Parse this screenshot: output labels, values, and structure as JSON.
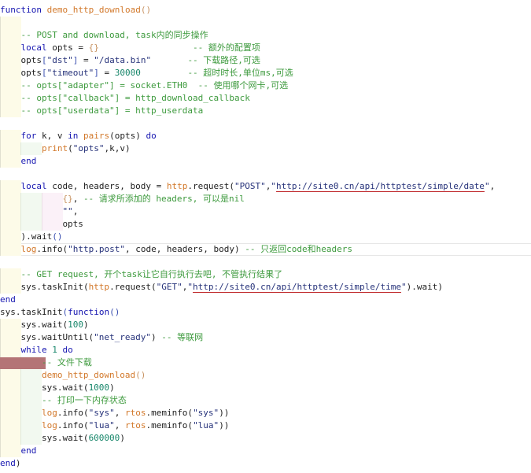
{
  "editor": {
    "language": "lua",
    "current_line": 20,
    "breakpoint_line": 29,
    "colors": {
      "keyword": "#1515b0",
      "function": "#d2782a",
      "comment": "#3d9a3d",
      "string": "#26327a",
      "number": "#17866a",
      "breakpoint": "#b47476",
      "url_underline": "#c0282b"
    },
    "lines": [
      {
        "indent": 0,
        "tokens": [
          [
            "kw",
            "function"
          ],
          [
            "id",
            " "
          ],
          [
            "fn",
            "demo_http_download"
          ],
          [
            "br",
            "()"
          ]
        ]
      },
      {
        "indent": 1,
        "tokens": []
      },
      {
        "indent": 1,
        "tokens": [
          [
            "cm",
            "-- POST and download, task内的同步操作"
          ]
        ]
      },
      {
        "indent": 1,
        "tokens": [
          [
            "kw",
            "local"
          ],
          [
            "id",
            " opts = "
          ],
          [
            "br",
            "{}"
          ],
          [
            "id",
            "                  "
          ],
          [
            "cm",
            "-- 额外的配置项"
          ]
        ]
      },
      {
        "indent": 1,
        "tokens": [
          [
            "id",
            "opts"
          ],
          [
            "pr",
            "["
          ],
          [
            "str",
            "\"dst\""
          ],
          [
            "pr",
            "]"
          ],
          [
            "id",
            " = "
          ],
          [
            "str",
            "\"/data.bin\""
          ],
          [
            "id",
            "       "
          ],
          [
            "cm",
            "-- 下载路径,可选"
          ]
        ]
      },
      {
        "indent": 1,
        "tokens": [
          [
            "id",
            "opts"
          ],
          [
            "pr",
            "["
          ],
          [
            "str",
            "\"timeout\""
          ],
          [
            "pr",
            "]"
          ],
          [
            "id",
            " = "
          ],
          [
            "num",
            "30000"
          ],
          [
            "id",
            "         "
          ],
          [
            "cm",
            "-- 超时时长,单位ms,可选"
          ]
        ]
      },
      {
        "indent": 1,
        "tokens": [
          [
            "cm",
            "-- opts[\"adapter\"] = socket.ETH0  -- 使用哪个网卡,可选"
          ]
        ]
      },
      {
        "indent": 1,
        "tokens": [
          [
            "cm",
            "-- opts[\"callback\"] = http_download_callback"
          ]
        ]
      },
      {
        "indent": 1,
        "tokens": [
          [
            "cm",
            "-- opts[\"userdata\"] = http_userdata"
          ]
        ]
      },
      {
        "indent": 0,
        "tokens": []
      },
      {
        "indent": 1,
        "tokens": [
          [
            "kw",
            "for"
          ],
          [
            "id",
            " k, v "
          ],
          [
            "kw",
            "in"
          ],
          [
            "id",
            " "
          ],
          [
            "fn",
            "pairs"
          ],
          [
            "id",
            "(opts) "
          ],
          [
            "kw",
            "do"
          ]
        ]
      },
      {
        "indent": 2,
        "tokens": [
          [
            "fn",
            "print"
          ],
          [
            "id",
            "("
          ],
          [
            "str",
            "\"opts\""
          ],
          [
            "id",
            ",k,v)"
          ]
        ]
      },
      {
        "indent": 1,
        "tokens": [
          [
            "kw",
            "end"
          ]
        ]
      },
      {
        "indent": 0,
        "tokens": []
      },
      {
        "indent": 1,
        "tokens": [
          [
            "kw",
            "local"
          ],
          [
            "id",
            " code, headers, body = "
          ],
          [
            "lib",
            "http"
          ],
          [
            "id",
            ".request("
          ],
          [
            "str",
            "\"POST\""
          ],
          [
            "id",
            ","
          ],
          [
            "str",
            "\""
          ],
          [
            "url",
            "http://site0.cn/api/httptest/simple/date"
          ],
          [
            "str",
            "\""
          ],
          [
            "id",
            ","
          ]
        ]
      },
      {
        "indent": 3,
        "tokens": [
          [
            "br",
            "{}"
          ],
          [
            "id",
            ", "
          ],
          [
            "cm",
            "-- 请求所添加的 headers, 可以是nil"
          ]
        ]
      },
      {
        "indent": 3,
        "tokens": [
          [
            "str",
            "\"\""
          ],
          [
            "id",
            ","
          ]
        ]
      },
      {
        "indent": 3,
        "tokens": [
          [
            "id",
            "opts"
          ]
        ]
      },
      {
        "indent": 1,
        "tokens": [
          [
            "id",
            ").wait"
          ],
          [
            "pr",
            "()"
          ]
        ]
      },
      {
        "indent": 1,
        "tokens": [
          [
            "lib",
            "log"
          ],
          [
            "id",
            ".info("
          ],
          [
            "str",
            "\"http.post\""
          ],
          [
            "id",
            ", code, headers, body) "
          ],
          [
            "cm",
            "-- 只返回code和headers"
          ]
        ]
      },
      {
        "indent": 0,
        "tokens": []
      },
      {
        "indent": 1,
        "tokens": [
          [
            "cm",
            "-- GET request, 开个task让它自行执行去吧, 不管执行结果了"
          ]
        ]
      },
      {
        "indent": 1,
        "tokens": [
          [
            "id",
            "sys.taskInit("
          ],
          [
            "lib",
            "http"
          ],
          [
            "id",
            ".request("
          ],
          [
            "str",
            "\"GET\""
          ],
          [
            "id",
            ","
          ],
          [
            "str",
            "\""
          ],
          [
            "url",
            "http://site0.cn/api/httptest/simple/time"
          ],
          [
            "str",
            "\""
          ],
          [
            "id",
            ").wait)"
          ]
        ]
      },
      {
        "indent": 0,
        "tokens": [
          [
            "kw",
            "end"
          ]
        ]
      },
      {
        "indent": 0,
        "tokens": [
          [
            "id",
            "sys.taskInit"
          ],
          [
            "pr",
            "("
          ],
          [
            "kw",
            "function"
          ],
          [
            "pr",
            "()"
          ]
        ]
      },
      {
        "indent": 1,
        "tokens": [
          [
            "id",
            "sys.wait("
          ],
          [
            "num",
            "100"
          ],
          [
            "id",
            ")"
          ]
        ]
      },
      {
        "indent": 1,
        "tokens": [
          [
            "id",
            "sys.waitUntil("
          ],
          [
            "str",
            "\"net_ready\""
          ],
          [
            "id",
            ") "
          ],
          [
            "cm",
            "-- 等联网"
          ]
        ]
      },
      {
        "indent": 1,
        "tokens": [
          [
            "kw",
            "while"
          ],
          [
            "id",
            " "
          ],
          [
            "num",
            "1"
          ],
          [
            "id",
            " "
          ],
          [
            "kw",
            "do"
          ]
        ]
      },
      {
        "indent": 2,
        "tokens": [
          [
            "cm",
            "-- 文件下载"
          ]
        ]
      },
      {
        "indent": 2,
        "tokens": [
          [
            "fn",
            "demo_http_download"
          ],
          [
            "br",
            "()"
          ]
        ]
      },
      {
        "indent": 2,
        "tokens": [
          [
            "id",
            "sys.wait("
          ],
          [
            "num",
            "1000"
          ],
          [
            "id",
            ")"
          ]
        ]
      },
      {
        "indent": 2,
        "tokens": [
          [
            "cm",
            "-- 打印一下内存状态"
          ]
        ]
      },
      {
        "indent": 2,
        "tokens": [
          [
            "lib",
            "log"
          ],
          [
            "id",
            ".info("
          ],
          [
            "str",
            "\"sys\""
          ],
          [
            "id",
            ", "
          ],
          [
            "lib",
            "rtos"
          ],
          [
            "id",
            ".meminfo("
          ],
          [
            "str",
            "\"sys\""
          ],
          [
            "id",
            "))"
          ]
        ]
      },
      {
        "indent": 2,
        "tokens": [
          [
            "lib",
            "log"
          ],
          [
            "id",
            ".info("
          ],
          [
            "str",
            "\"lua\""
          ],
          [
            "id",
            ", "
          ],
          [
            "lib",
            "rtos"
          ],
          [
            "id",
            ".meminfo("
          ],
          [
            "str",
            "\"lua\""
          ],
          [
            "id",
            "))"
          ]
        ]
      },
      {
        "indent": 2,
        "tokens": [
          [
            "id",
            "sys.wait("
          ],
          [
            "num",
            "600000"
          ],
          [
            "id",
            ")"
          ]
        ]
      },
      {
        "indent": 1,
        "tokens": [
          [
            "kw",
            "end"
          ]
        ]
      },
      {
        "indent": 0,
        "tokens": [
          [
            "kw",
            "end"
          ],
          [
            "id",
            ")"
          ]
        ]
      }
    ]
  }
}
